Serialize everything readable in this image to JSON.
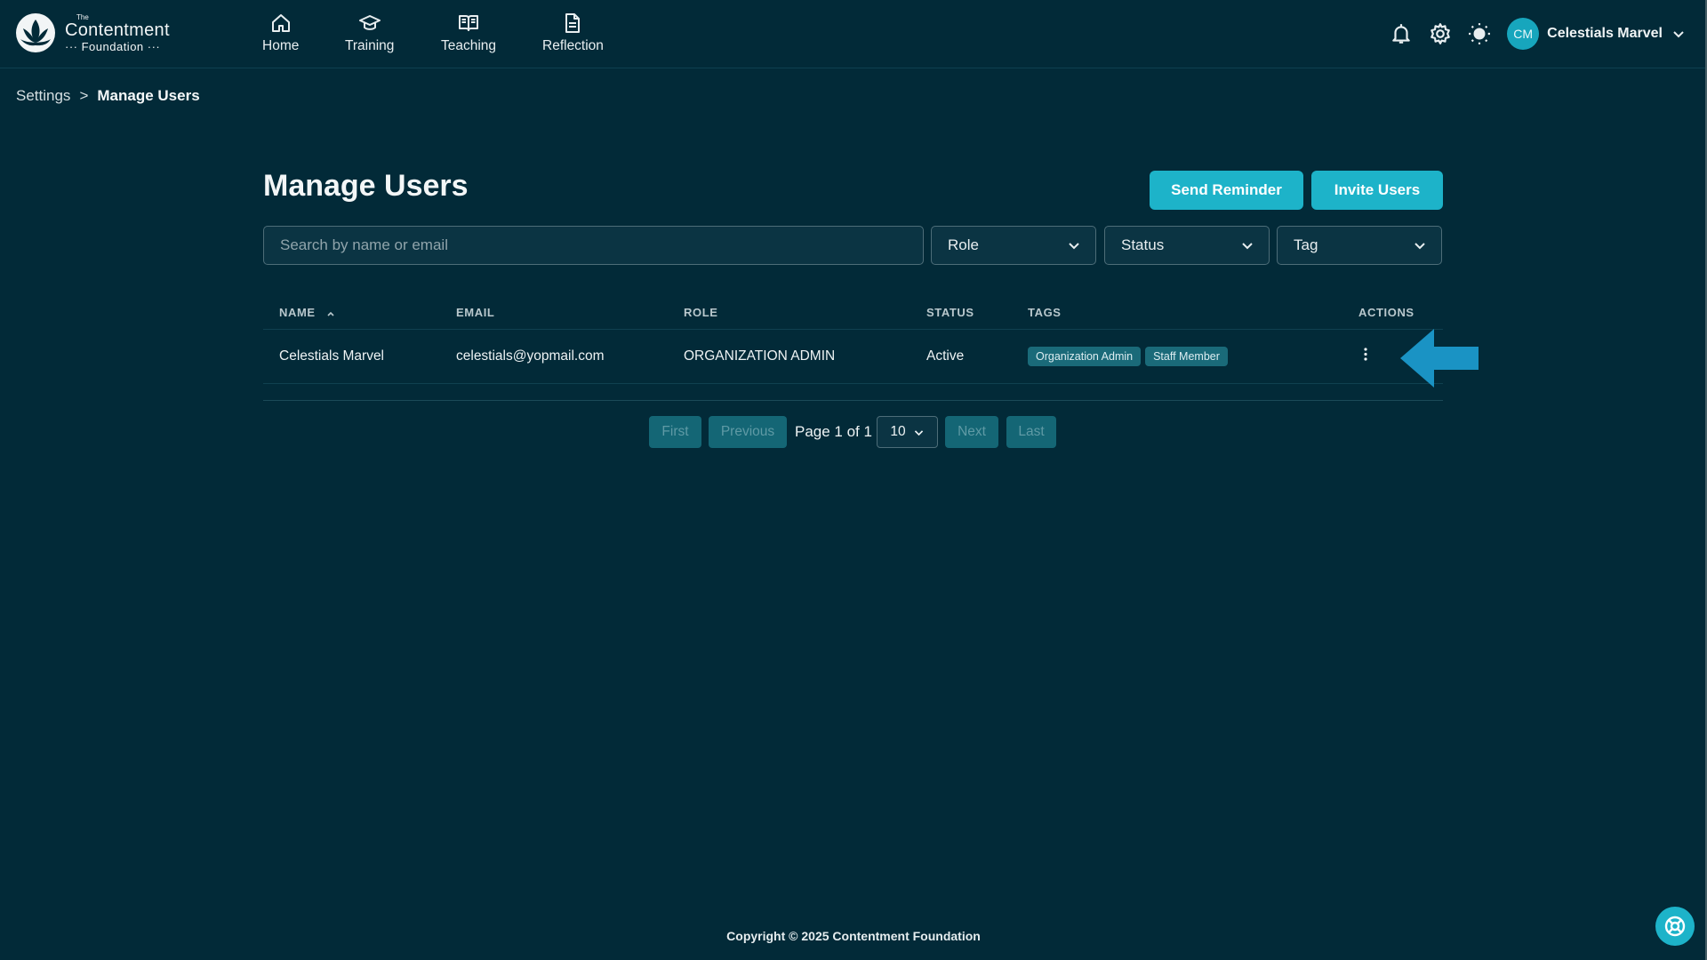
{
  "brand": {
    "the": "The",
    "name": "Contentment",
    "sub": "··· Foundation ···"
  },
  "nav": {
    "home": "Home",
    "training": "Training",
    "teaching": "Teaching",
    "reflection": "Reflection"
  },
  "user": {
    "initials": "CM",
    "name": "Celestials Marvel"
  },
  "breadcrumb": {
    "parent": "Settings",
    "separator": ">",
    "current": "Manage Users"
  },
  "page": {
    "title": "Manage Users",
    "send_reminder": "Send Reminder",
    "invite_users": "Invite Users"
  },
  "filters": {
    "search_placeholder": "Search by name or email",
    "role": "Role",
    "status": "Status",
    "tag": "Tag"
  },
  "table": {
    "headers": {
      "name": "NAME",
      "email": "EMAIL",
      "role": "ROLE",
      "status": "STATUS",
      "tags": "TAGS",
      "actions": "ACTIONS"
    },
    "rows": [
      {
        "name": "Celestials Marvel",
        "email": "celestials@yopmail.com",
        "role": "ORGANIZATION ADMIN",
        "status": "Active",
        "tags": [
          "Organization Admin",
          "Staff Member"
        ]
      }
    ]
  },
  "pagination": {
    "first": "First",
    "previous": "Previous",
    "page_label": "Page 1 of 1",
    "page_size": "10",
    "next": "Next",
    "last": "Last"
  },
  "footer": {
    "copyright": "Copyright © 2025 Contentment Foundation"
  },
  "colors": {
    "background": "#022a38",
    "accent": "#1db3c9",
    "tag": "#1a6a79",
    "arrow": "#1a93c4"
  },
  "icons": [
    "home-icon",
    "graduation-cap-icon",
    "open-book-icon",
    "document-icon",
    "bell-icon",
    "gear-icon",
    "sun-icon",
    "chevron-down-icon",
    "sort-up-icon",
    "more-vertical-icon",
    "life-ring-icon"
  ]
}
